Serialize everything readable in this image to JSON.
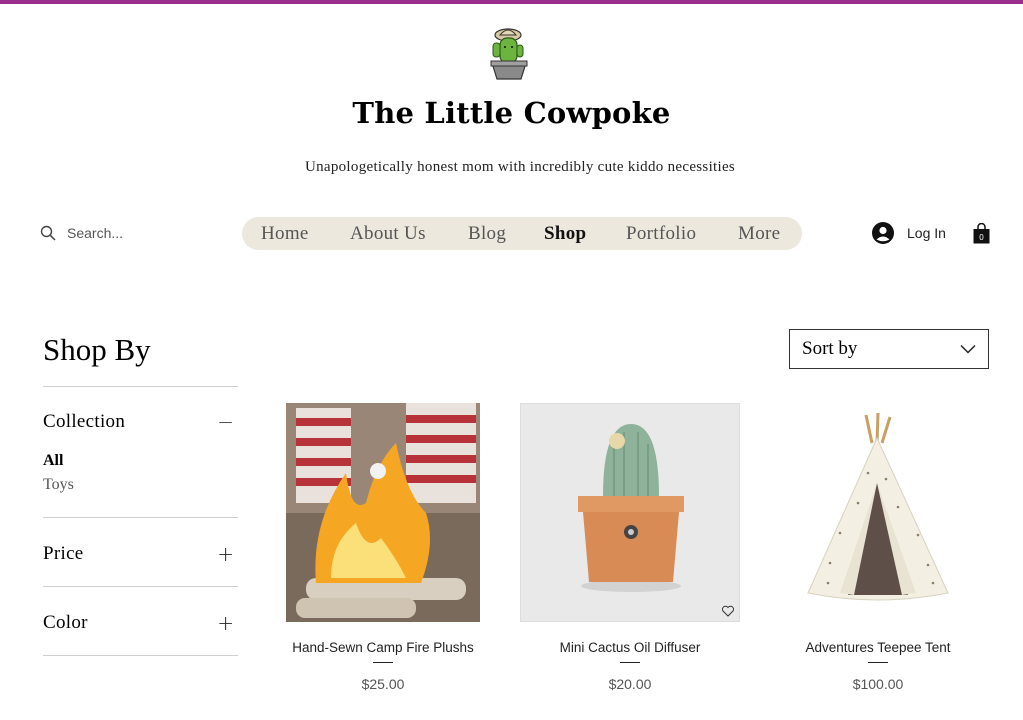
{
  "site": {
    "title": "The Little Cowpoke",
    "tagline": "Unapologetically honest mom with incredibly cute kiddo necessities"
  },
  "search": {
    "placeholder": "Search..."
  },
  "nav": {
    "items": [
      {
        "label": "Home"
      },
      {
        "label": "About Us"
      },
      {
        "label": "Blog"
      },
      {
        "label": "Shop"
      },
      {
        "label": "Portfolio"
      },
      {
        "label": "More"
      }
    ],
    "active": "Shop"
  },
  "account": {
    "login_label": "Log In",
    "cart_count": "0"
  },
  "sidebar": {
    "heading": "Shop By",
    "collection": {
      "label": "Collection",
      "options": [
        "All",
        "Toys"
      ],
      "selected": "All"
    },
    "price": {
      "label": "Price"
    },
    "color": {
      "label": "Color"
    }
  },
  "sort": {
    "label": "Sort by"
  },
  "products": [
    {
      "name": "Hand-Sewn Camp Fire Plushs",
      "price": "$25.00"
    },
    {
      "name": "Mini Cactus Oil Diffuser",
      "price": "$20.00"
    },
    {
      "name": "Adventures Teepee Tent",
      "price": "$100.00"
    }
  ],
  "colors": {
    "accent_bar": "#9b2d8f",
    "nav_bg": "#ede8dd"
  }
}
